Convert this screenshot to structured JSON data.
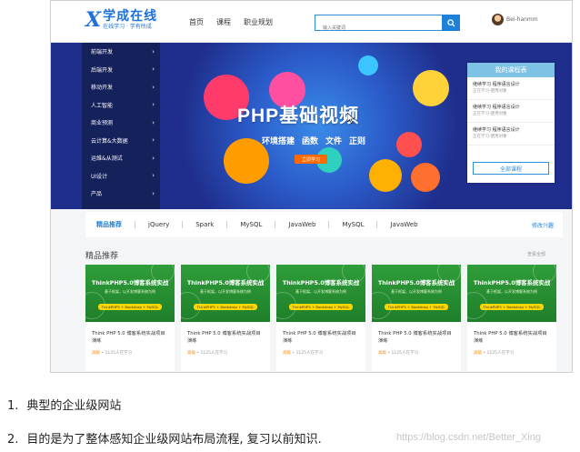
{
  "colors": {
    "brand": "#1e6fd9",
    "banner": "#1f2e8c",
    "accent": "#ff6a00",
    "card_green": "#2f9d3a"
  },
  "header": {
    "logo_mark": "X",
    "logo_name": "学成在线",
    "logo_slogan": "在线学习 · 学有所成",
    "nav": [
      "首页",
      "课程",
      "职业规划"
    ],
    "search_placeholder": "输入关键词",
    "search_icon": "search-icon",
    "username": "Bei-hanmm"
  },
  "banner": {
    "sidebar": [
      "前端开发",
      "后端开发",
      "移动开发",
      "人工智能",
      "商业预测",
      "云计算&大数据",
      "运维&从测试",
      "UI设计",
      "产品"
    ],
    "headline": "PHP基础视频",
    "sublines": [
      "环境搭建",
      "函数",
      "文件",
      "正则"
    ],
    "cta": "立即学习",
    "panel": {
      "title": "我的课程表",
      "courses": [
        {
          "title": "继续学习 程序语言设计",
          "sub": "正在学习-使用对象"
        },
        {
          "title": "继续学习 程序语言设计",
          "sub": "正在学习-使用对象"
        },
        {
          "title": "继续学习 程序语言设计",
          "sub": "正在学习-使用对象"
        }
      ],
      "all_button": "全部课程"
    }
  },
  "subnav": {
    "items": [
      "精品推荐",
      "jQuery",
      "Spark",
      "MySQL",
      "JavaWeb",
      "MySQL",
      "JavaWeb"
    ],
    "edit": "修改兴趣"
  },
  "section": {
    "title": "精品推荐",
    "more": "查看全部",
    "cards": [
      {
        "thumb_title": "ThinkPHP5.0博客系统实战",
        "thumb_sub": "基于框架，以开发博客系统为例",
        "thumb_tag": "ThinkPHP5 + Bootstrap + MySQL",
        "title": "Think PHP 5.0 博客系统实战项目演练",
        "level": "高级",
        "meta": " • 1125人在学习"
      },
      {
        "thumb_title": "ThinkPHP5.0博客系统实战",
        "thumb_sub": "基于框架，以开发博客系统为例",
        "thumb_tag": "ThinkPHP5 + Bootstrap + MySQL",
        "title": "Think PHP 5.0 博客系统实战项目演练",
        "level": "高级",
        "meta": " • 1125人在学习"
      },
      {
        "thumb_title": "ThinkPHP5.0博客系统实战",
        "thumb_sub": "基于框架，以开发博客系统为例",
        "thumb_tag": "ThinkPHP5 + Bootstrap + MySQL",
        "title": "Think PHP 5.0 博客系统实战项目演练",
        "level": "高级",
        "meta": " • 1125人在学习"
      },
      {
        "thumb_title": "ThinkPHP5.0博客系统实战",
        "thumb_sub": "基于框架，以开发博客系统为例",
        "thumb_tag": "ThinkPHP5 + Bootstrap + MySQL",
        "title": "Think PHP 5.0 博客系统实战项目演练",
        "level": "高级",
        "meta": " • 1125人在学习"
      },
      {
        "thumb_title": "ThinkPHP5.0博客系统实战",
        "thumb_sub": "基于框架，以开发博客系统为例",
        "thumb_tag": "ThinkPHP5 + Bootstrap + MySQL",
        "title": "Think PHP 5.0 博客系统实战项目演练",
        "level": "高级",
        "meta": " • 1125人在学习"
      }
    ]
  },
  "notes": [
    {
      "num": "1.",
      "text": "典型的企业级网站"
    },
    {
      "num": "2.",
      "text": "目的是为了整体感知企业级网站布局流程, 复习以前知识."
    }
  ],
  "watermark": "https://blog.csdn.net/Better_Xing"
}
